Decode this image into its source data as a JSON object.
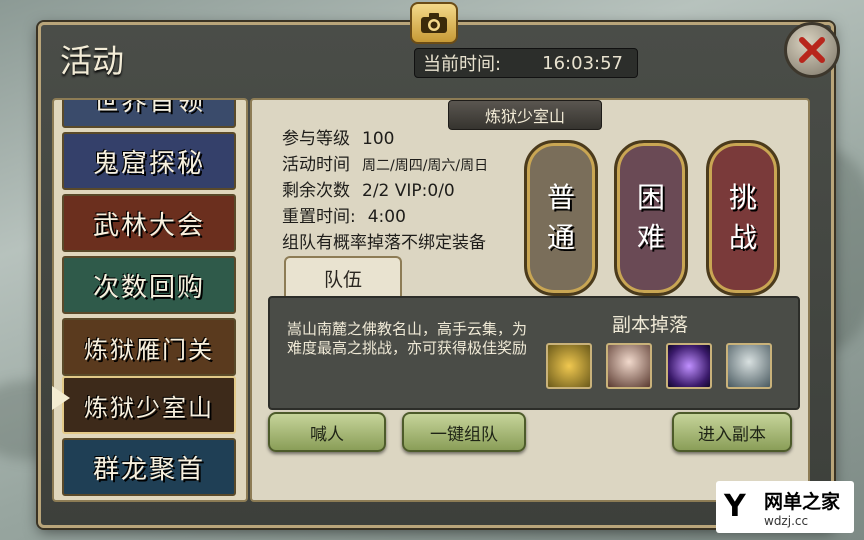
{
  "header": {
    "title": "活动",
    "time_label": "当前时间:",
    "time_value": "16:03:57"
  },
  "sidebar": {
    "items": [
      {
        "label": "世界首领",
        "color": "#3a4b6b"
      },
      {
        "label": "鬼窟探秘",
        "color": "#34406a"
      },
      {
        "label": "武林大会",
        "color": "#6b2f1e"
      },
      {
        "label": "次数回购",
        "color": "#2f5a4a"
      },
      {
        "label": "炼狱雁门关",
        "color": "#5a3a1e"
      },
      {
        "label": "炼狱少室山",
        "color": "#3d2a1a"
      },
      {
        "label": "群龙聚首",
        "color": "#1f3f55"
      }
    ],
    "selected_index": 5
  },
  "dungeon": {
    "name": "炼狱少室山",
    "info": [
      {
        "label": "参与等级",
        "value": "100"
      },
      {
        "label": "活动时间",
        "value": "周二/周四/周六/周日"
      },
      {
        "label": "剩余次数",
        "value": "2/2 VIP:0/0"
      },
      {
        "label": "重置时间:",
        "value": "4:00"
      },
      {
        "label": "组队有概率掉落不绑定装备",
        "value": ""
      }
    ],
    "difficulty": [
      {
        "char1": "普",
        "char2": "通",
        "color": "#7a6e5a"
      },
      {
        "char1": "困",
        "char2": "难",
        "color": "#6a4a55"
      },
      {
        "char1": "挑",
        "char2": "战",
        "color": "#7a3a3a"
      }
    ]
  },
  "team": {
    "tab_label": "队伍",
    "description": "嵩山南麓之佛教名山，高手云集，为难度最高之挑战，亦可获得极佳奖励",
    "drops_title": "副本掉落",
    "drops": [
      {
        "icon": "gold-weapon-icon",
        "color": "#6b5a1a"
      },
      {
        "icon": "female-portrait-icon",
        "color": "#e0c0b0"
      },
      {
        "icon": "purple-orb-icon",
        "color": "#3a1a6a"
      },
      {
        "icon": "male-portrait-icon",
        "color": "#8aa0a8"
      }
    ]
  },
  "buttons": {
    "shout": "喊人",
    "quick_team": "一键组队",
    "enter": "进入副本"
  },
  "watermark": {
    "name": "网单之家",
    "url": "wdzj.cc"
  }
}
